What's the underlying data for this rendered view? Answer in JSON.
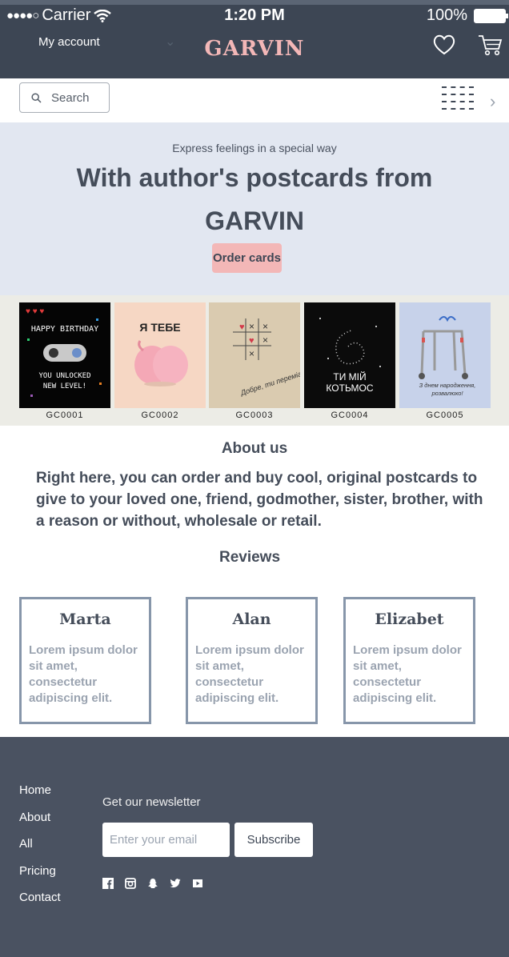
{
  "status_bar": {
    "carrier": "Carrier",
    "time": "1:20 PM",
    "battery": "100%"
  },
  "header": {
    "account_label": "My account",
    "brand": "GARVIN",
    "icons": [
      "heart-icon",
      "cart-icon"
    ]
  },
  "search": {
    "label": "Search"
  },
  "hero": {
    "subtitle": "Express feelings in a special way",
    "title": "With author's postcards from GARVIN",
    "button": "Order cards"
  },
  "cards": [
    {
      "code": "GC0001",
      "text": "HAPPY BIRTHDAY\nYOU UNLOCKED\nNEW LEVEL!"
    },
    {
      "code": "GC0002",
      "text": "Я ТЕБЕ"
    },
    {
      "code": "GC0003",
      "text": "Добре, ти переміг!"
    },
    {
      "code": "GC0004",
      "text": "ТИ МІЙ\nКОТЬМОС"
    },
    {
      "code": "GC0005",
      "text": "З днем народження, розвалюхо!"
    }
  ],
  "about": {
    "heading": "About us",
    "text": "Right here, you can order and buy cool, original postcards to give to your loved one, friend, godmother, sister, brother, with a reason or without, wholesale or retail."
  },
  "reviews": {
    "heading": "Reviews",
    "items": [
      {
        "name": "Marta",
        "text": "Lorem ipsum dolor sit amet, consectetur adipiscing elit."
      },
      {
        "name": "Alan",
        "text": "Lorem ipsum dolor sit amet, consectetur adipiscing elit."
      },
      {
        "name": "Elizabet",
        "text": "Lorem ipsum dolor sit amet, consectetur adipiscing elit."
      }
    ]
  },
  "footer": {
    "links": [
      "Home",
      "About",
      "All",
      "Pricing",
      "Contact"
    ],
    "newsletter_heading": "Get our newsletter",
    "email_placeholder": "Enter your email",
    "subscribe": "Subscribe",
    "socials": [
      "facebook-icon",
      "instagram-icon",
      "snapchat-icon",
      "twitter-icon",
      "youtube-icon"
    ]
  },
  "colors": {
    "primary": "#3d4654",
    "accent": "#f3b7b7",
    "hero_bg": "#e2e7f1",
    "footer_bg": "#4a5261",
    "review_border": "#8796aa"
  }
}
